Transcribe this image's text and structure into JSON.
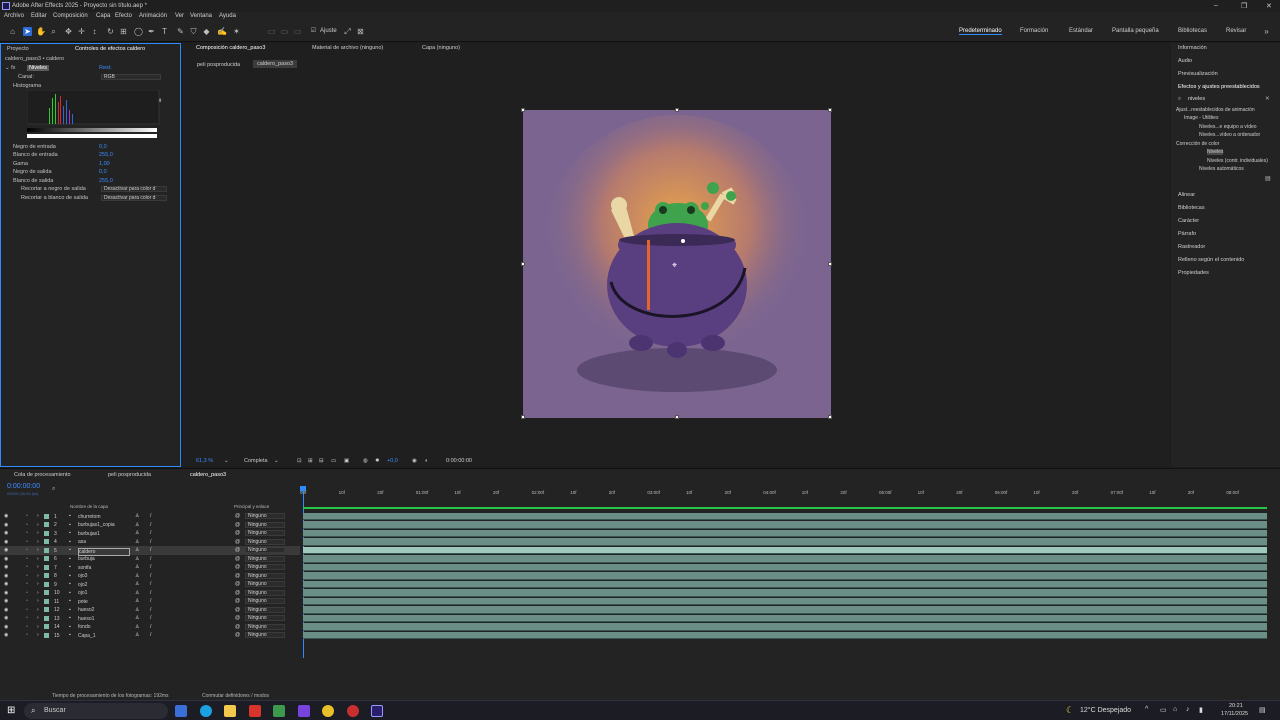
{
  "window": {
    "title": "Adobe After Effects 2025 - Proyecto sin título.aep *"
  },
  "menu": [
    "Archivo",
    "Editar",
    "Composición",
    "Capa",
    "Efecto",
    "Animación",
    "Ver",
    "Ventana",
    "Ayuda"
  ],
  "toolbar": {
    "ajuste_label": "Ajuste"
  },
  "workspaces": [
    "Predeterminado",
    "Formación",
    "Estándar",
    "Pantalla pequeña",
    "Bibliotecas",
    "Revisar"
  ],
  "left": {
    "tabs": [
      "Proyecto",
      "Controles de efectos caldero"
    ],
    "breadcrumb": "caldero_paso3 • caldero",
    "effect_name": "Niveles",
    "reset": "Rest.",
    "channel_label": "Canal:",
    "channel_value": "RGB",
    "histogram_label": "Histograma",
    "params": [
      {
        "label": "Negro de entrada",
        "value": "0,0"
      },
      {
        "label": "Blanco de entrada",
        "value": "255,0"
      },
      {
        "label": "Gama",
        "value": "1,00"
      },
      {
        "label": "Negro de salida",
        "value": "0,0"
      },
      {
        "label": "Blanco de salida",
        "value": "255,0"
      }
    ],
    "clip": [
      {
        "label": "Recortar a negro de salida",
        "value": "Desactivar para color d"
      },
      {
        "label": "Recortar a blanco de salida",
        "value": "Desactivar para color d"
      }
    ]
  },
  "viewer": {
    "tabs": [
      "Composición caldero_paso3",
      "Material de archivo (ninguno)",
      "Capa (ninguno)"
    ],
    "subtabs": [
      "peli posproducida",
      "caldero_paso3"
    ],
    "zoom": "61,3 %",
    "quality": "Completa",
    "exposure": "+0,0",
    "timecode": "0:00:00:00"
  },
  "right": {
    "items": [
      "Información",
      "Audio",
      "Previsualización"
    ],
    "effects_title": "Efectos y ajustes preestablecidos",
    "search": "niveles",
    "tree": [
      "Ajust...reestablecidos de animación",
      "Image - Utilities",
      "Niveles...e equipo a vídeo",
      "Niveles...vídeo a ordenador",
      "Corrección de color",
      "Niveles",
      "Niveles (contr. individuales)",
      "Niveles automáticos"
    ],
    "bottom": [
      "Alinear",
      "Bibliotecas",
      "Carácter",
      "Párrafo",
      "Rastreador",
      "Relleno según el contenido",
      "Propiedades"
    ]
  },
  "timeline": {
    "tabs": [
      "Cola de procesamiento",
      "peli posproducida",
      "caldero_paso3"
    ],
    "timecode": "0:00:00:00",
    "fps": "00000 (30.00 fps)",
    "col_name": "Nombre de la capa",
    "col_parent": "Principal y enlace",
    "layers": [
      {
        "n": "1",
        "name": "churretom"
      },
      {
        "n": "2",
        "name": "burbujas1_copia"
      },
      {
        "n": "3",
        "name": "burbujas1"
      },
      {
        "n": "4",
        "name": "asa"
      },
      {
        "n": "5",
        "name": "caldero"
      },
      {
        "n": "6",
        "name": "burbuja"
      },
      {
        "n": "7",
        "name": "sonifa"
      },
      {
        "n": "8",
        "name": "ojo3"
      },
      {
        "n": "9",
        "name": "ojo2"
      },
      {
        "n": "10",
        "name": "ojo1"
      },
      {
        "n": "11",
        "name": "pote"
      },
      {
        "n": "12",
        "name": "hueso2"
      },
      {
        "n": "13",
        "name": "hueso1"
      },
      {
        "n": "14",
        "name": "fondo"
      },
      {
        "n": "15",
        "name": "Capa_1"
      }
    ],
    "parent_value": "Ninguno",
    "ruler": [
      "00f",
      "10f",
      "20f",
      "01:00f",
      "10f",
      "20f",
      "02:00f",
      "10f",
      "20f",
      "03:00f",
      "10f",
      "20f",
      "04:00f",
      "10f",
      "20f",
      "05:00f",
      "10f",
      "20f",
      "06:00f",
      "10f",
      "20f",
      "07:00f",
      "10f",
      "20f",
      "08:00f"
    ],
    "status_left": "Tiempo de procesamiento de los fotogramas: 192ms",
    "status_mid": "Conmutar definidores / modos"
  },
  "taskbar": {
    "search": "Buscar",
    "weather": "12°C Despejado",
    "time": "20:21",
    "date": "17/11/2025"
  }
}
